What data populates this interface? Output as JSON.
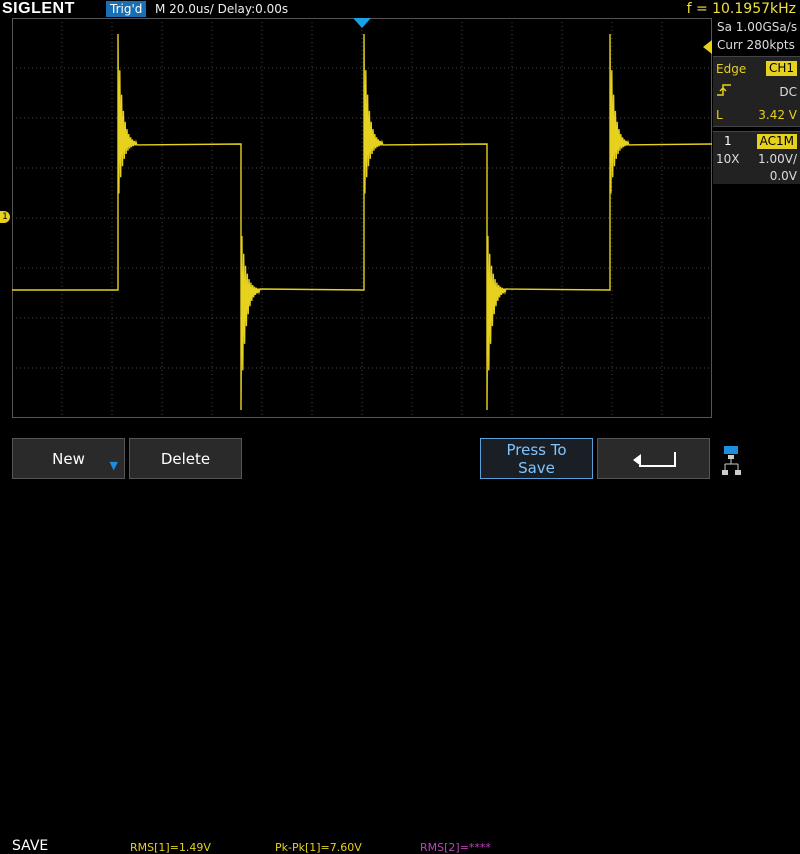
{
  "header": {
    "brand": "SIGLENT",
    "trigger_status": "Trig'd",
    "timebase": "M 20.0us/  Delay:0.00s",
    "frequency": "f = 10.1957kHz"
  },
  "acquisition": {
    "sample_rate": "Sa 1.00GSa/s",
    "memory": "Curr 280kpts"
  },
  "trigger": {
    "type": "Edge",
    "source": "CH1",
    "coupling": "DC",
    "level_label": "L",
    "level": "3.42 V"
  },
  "channel": {
    "number": "1",
    "coupling": "AC1M",
    "probe": "10X",
    "scale": "1.00V/",
    "offset": "0.0V",
    "marker_label": "1"
  },
  "measurements": {
    "menu_title": "SAVE",
    "rms1": "RMS[1]=1.49V",
    "pkpk1": "Pk-Pk[1]=7.60V",
    "rms2": "RMS[2]=****"
  },
  "softkeys": {
    "new": "New",
    "delete": "Delete",
    "press_to_save_line1": "Press To",
    "press_to_save_line2": "Save",
    "back_icon": "return-arrow-icon",
    "network_icon": "network-icon"
  },
  "colors": {
    "trace": "#e6d11f",
    "accent": "#1a6fb4",
    "grid": "#555555"
  }
}
